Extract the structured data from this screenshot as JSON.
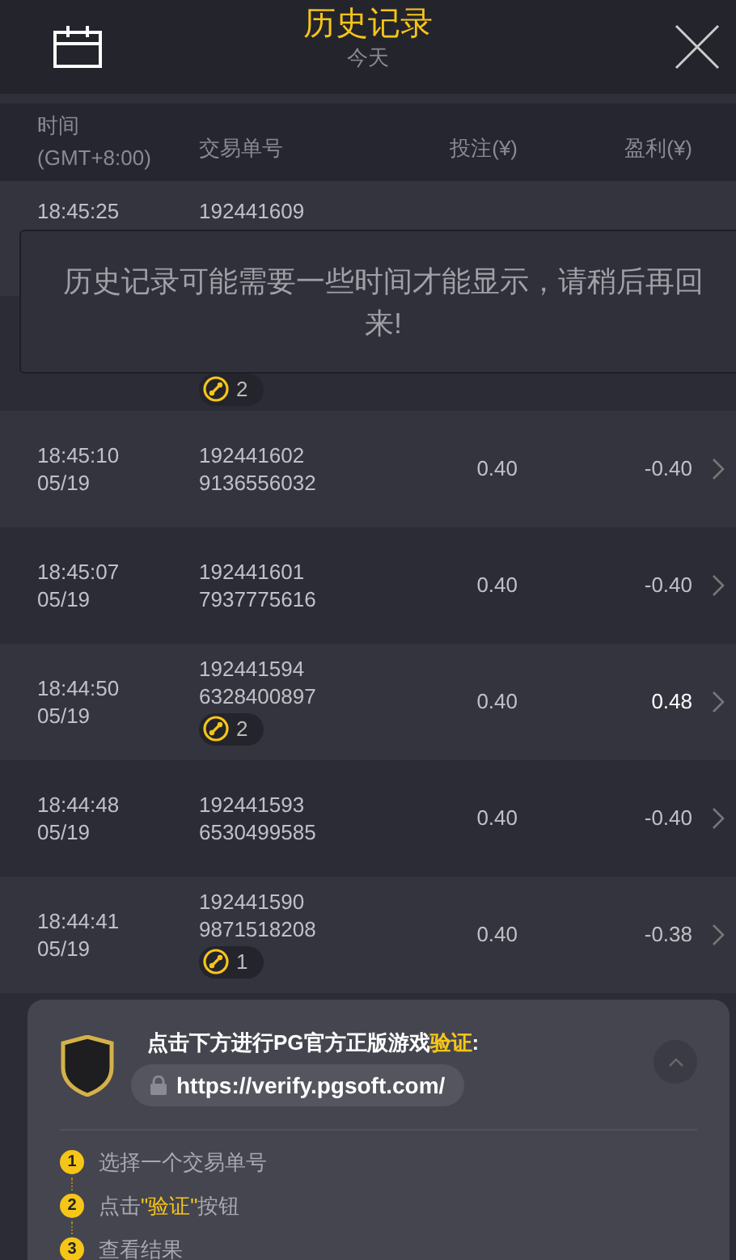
{
  "header": {
    "title": "历史记录",
    "subtitle": "今天"
  },
  "table": {
    "columns": [
      {
        "label": "时间",
        "sub": "(GMT+8:00)"
      },
      {
        "label": "交易单号"
      },
      {
        "label": "投注(¥)"
      },
      {
        "label": "盈利(¥)"
      }
    ],
    "rows": [
      {
        "time": "18:45:25",
        "order": "192441609"
      },
      {
        "badge": "2"
      },
      {
        "time": "18:45:10",
        "date": "05/19",
        "order": "192441602",
        "order2": "9136556032",
        "bet": "0.40",
        "profit": "-0.40",
        "win": false
      },
      {
        "time": "18:45:07",
        "date": "05/19",
        "order": "192441601",
        "order2": "7937775616",
        "bet": "0.40",
        "profit": "-0.40",
        "win": false
      },
      {
        "time": "18:44:50",
        "date": "05/19",
        "order": "192441594",
        "order2": "6328400897",
        "badge": "2",
        "bet": "0.40",
        "profit": "0.48",
        "win": true
      },
      {
        "time": "18:44:48",
        "date": "05/19",
        "order": "192441593",
        "order2": "6530499585",
        "bet": "0.40",
        "profit": "-0.40",
        "win": false
      },
      {
        "time": "18:44:41",
        "date": "05/19",
        "order": "192441590",
        "order2": "9871518208",
        "badge": "1",
        "bet": "0.40",
        "profit": "-0.38",
        "win": false
      }
    ]
  },
  "toast": "历史记录可能需要一些时间才能显示，请稍后再回来!",
  "verify": {
    "title": "点击下方进行PG官方正版游戏**验证**:",
    "url": "https://verify.pgsoft.com/",
    "expanded": true,
    "steps": [
      {
        "number": "1",
        "text": "选择一个交易单号"
      },
      {
        "number": "2",
        "text": "点击**\"验证\"**按钮"
      },
      {
        "number": "3",
        "text": "查看结果"
      }
    ]
  }
}
